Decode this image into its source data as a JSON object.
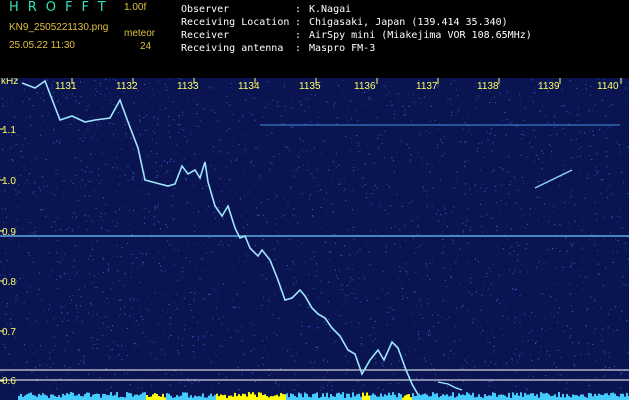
{
  "header": {
    "app_title": "HROFFT",
    "version": "1.00f",
    "filename": "KN9_2505221130.png",
    "timestamp": "25.05.22 11:30",
    "mode_label": "meteor",
    "mode_value": "24",
    "info": [
      {
        "key": "Observer",
        "value": "K.Nagai"
      },
      {
        "key": "Receiving Location",
        "value": "Chigasaki, Japan (139.414 35.340)"
      },
      {
        "key": "Receiver",
        "value": "AirSpy mini (Miakejima VOR 108.65MHz)"
      },
      {
        "key": "Receiving antenna",
        "value": "Maspro FM-3"
      }
    ]
  },
  "spectrogram": {
    "y_unit": "kHz",
    "x_ticks": [
      "1131",
      "1132",
      "1133",
      "1134",
      "1135",
      "1136",
      "1137",
      "1138",
      "1139",
      "1140"
    ],
    "y_ticks": [
      "1.1",
      "1.0",
      "0.9",
      "0.8",
      "0.7",
      "0.6"
    ],
    "colors": {
      "background": "#0a1450",
      "signal": "#7fd8ff",
      "label": "#ffff66",
      "baseline": "#ffff00"
    }
  }
}
